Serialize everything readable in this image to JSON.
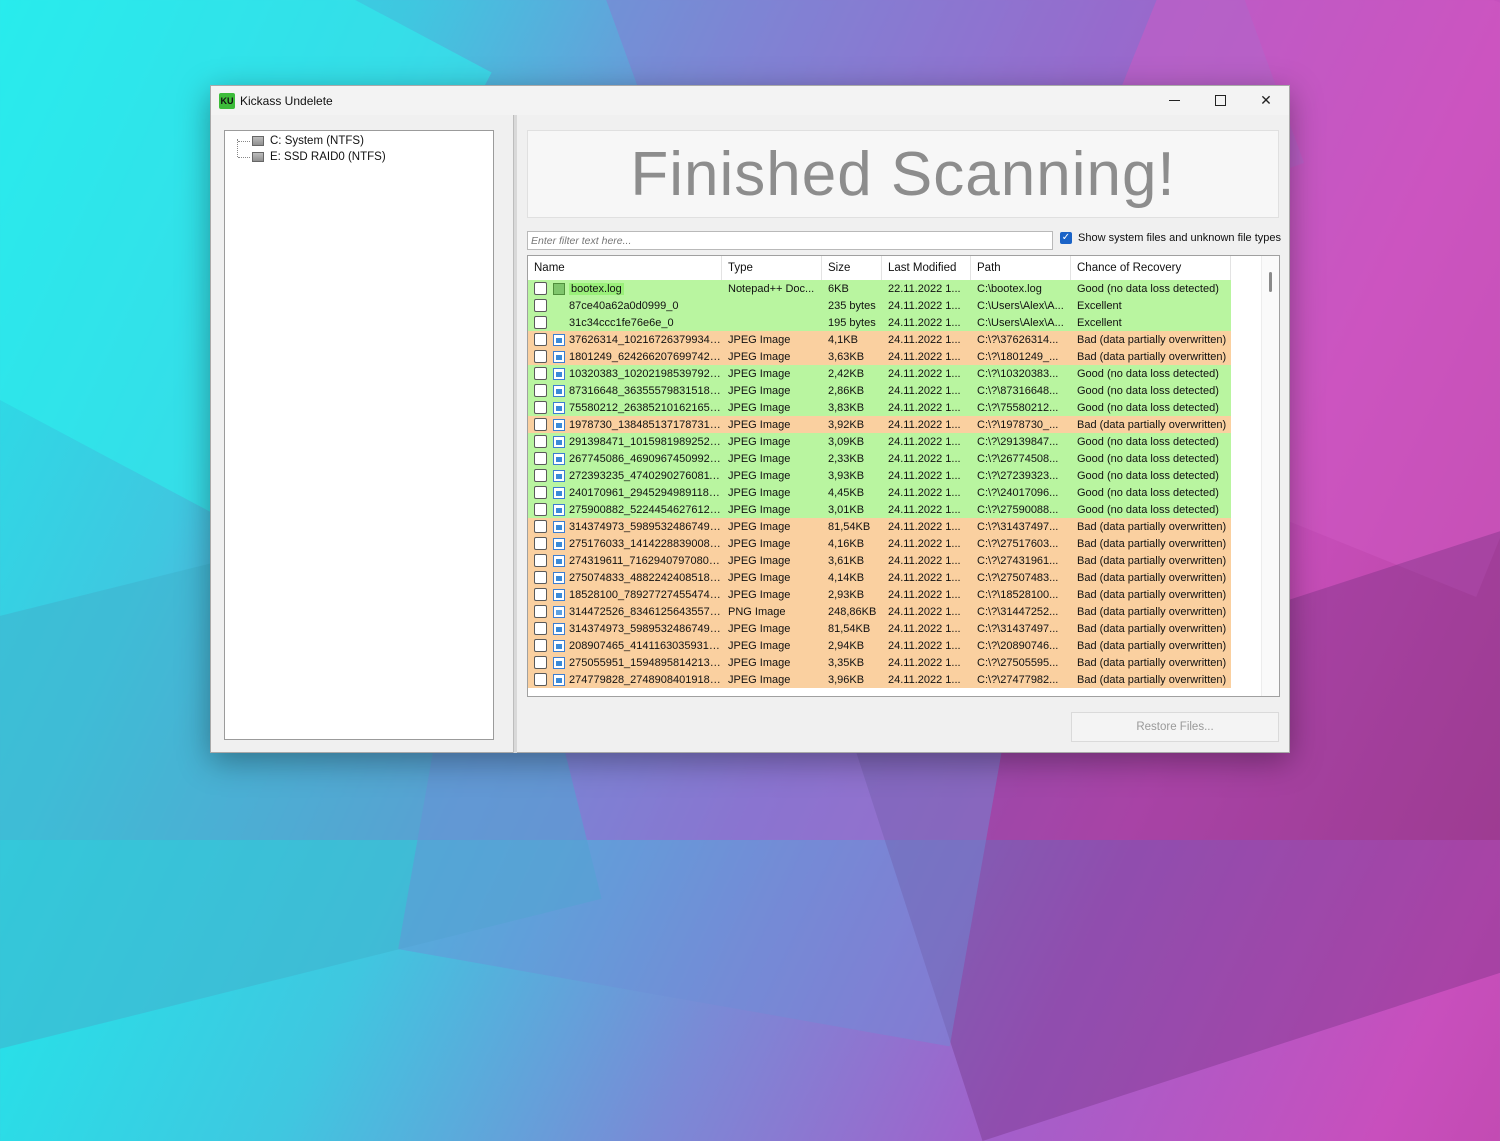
{
  "window": {
    "app_icon_text": "KU",
    "title": "Kickass Undelete",
    "controls": {
      "minimize": "minimize",
      "maximize": "maximize",
      "close": "✕"
    }
  },
  "drives": [
    {
      "label": "C: System (NTFS)"
    },
    {
      "label": "E: SSD RAID0 (NTFS)"
    }
  ],
  "banner": "Finished Scanning!",
  "filter": {
    "placeholder": "Enter filter text here...",
    "value": ""
  },
  "show_system_files": {
    "label": "Show system files and unknown file types",
    "checked": true
  },
  "table": {
    "columns": [
      "Name",
      "Type",
      "Size",
      "Last Modified",
      "Path",
      "Chance of Recovery"
    ],
    "rows": [
      {
        "name": "bootex.log",
        "type": "Notepad++ Doc...",
        "size": "6KB",
        "modified": "22.11.2022 1...",
        "path": "C:\\bootex.log",
        "chance": "Good (no data loss detected)",
        "status": "good",
        "icon": "txt"
      },
      {
        "name": "87ce40a62a0d0999_0",
        "type": "",
        "size": "235 bytes",
        "modified": "24.11.2022 1...",
        "path": "C:\\Users\\Alex\\A...",
        "chance": "Excellent",
        "status": "good",
        "icon": "none"
      },
      {
        "name": "31c34ccc1fe76e6e_0",
        "type": "",
        "size": "195 bytes",
        "modified": "24.11.2022 1...",
        "path": "C:\\Users\\Alex\\A...",
        "chance": "Excellent",
        "status": "good",
        "icon": "none"
      },
      {
        "name": "37626314_102167263799347...",
        "type": "JPEG Image",
        "size": "4,1KB",
        "modified": "24.11.2022 1...",
        "path": "C:\\?\\37626314...",
        "chance": "Bad (data partially overwritten)",
        "status": "bad",
        "icon": "jpeg"
      },
      {
        "name": "1801249_624266207699742_...",
        "type": "JPEG Image",
        "size": "3,63KB",
        "modified": "24.11.2022 1...",
        "path": "C:\\?\\1801249_...",
        "chance": "Bad (data partially overwritten)",
        "status": "bad",
        "icon": "jpeg"
      },
      {
        "name": "10320383_102021985397928...",
        "type": "JPEG Image",
        "size": "2,42KB",
        "modified": "24.11.2022 1...",
        "path": "C:\\?\\10320383...",
        "chance": "Good (no data loss detected)",
        "status": "good",
        "icon": "jpeg"
      },
      {
        "name": "87316648_363555798315187...",
        "type": "JPEG Image",
        "size": "2,86KB",
        "modified": "24.11.2022 1...",
        "path": "C:\\?\\87316648...",
        "chance": "Good (no data loss detected)",
        "status": "good",
        "icon": "jpeg"
      },
      {
        "name": "75580212_263852101621658...",
        "type": "JPEG Image",
        "size": "3,83KB",
        "modified": "24.11.2022 1...",
        "path": "C:\\?\\75580212...",
        "chance": "Good (no data loss detected)",
        "status": "good",
        "icon": "jpeg"
      },
      {
        "name": "1978730_1384851371787317...",
        "type": "JPEG Image",
        "size": "3,92KB",
        "modified": "24.11.2022 1...",
        "path": "C:\\?\\1978730_...",
        "chance": "Bad (data partially overwritten)",
        "status": "bad",
        "icon": "jpeg"
      },
      {
        "name": "291398471_10159819892523...",
        "type": "JPEG Image",
        "size": "3,09KB",
        "modified": "24.11.2022 1...",
        "path": "C:\\?\\29139847...",
        "chance": "Good (no data loss detected)",
        "status": "good",
        "icon": "jpeg"
      },
      {
        "name": "267745086_46909674509927...",
        "type": "JPEG Image",
        "size": "2,33KB",
        "modified": "24.11.2022 1...",
        "path": "C:\\?\\26774508...",
        "chance": "Good (no data loss detected)",
        "status": "good",
        "icon": "jpeg"
      },
      {
        "name": "272393235_47402902760811...",
        "type": "JPEG Image",
        "size": "3,93KB",
        "modified": "24.11.2022 1...",
        "path": "C:\\?\\27239323...",
        "chance": "Good (no data loss detected)",
        "status": "good",
        "icon": "jpeg"
      },
      {
        "name": "240170961_29452949891188...",
        "type": "JPEG Image",
        "size": "4,45KB",
        "modified": "24.11.2022 1...",
        "path": "C:\\?\\24017096...",
        "chance": "Good (no data loss detected)",
        "status": "good",
        "icon": "jpeg"
      },
      {
        "name": "275900882_52244546276128...",
        "type": "JPEG Image",
        "size": "3,01KB",
        "modified": "24.11.2022 1...",
        "path": "C:\\?\\27590088...",
        "chance": "Good (no data loss detected)",
        "status": "good",
        "icon": "jpeg"
      },
      {
        "name": "314374973_59895324867494...",
        "type": "JPEG Image",
        "size": "81,54KB",
        "modified": "24.11.2022 1...",
        "path": "C:\\?\\31437497...",
        "chance": "Bad (data partially overwritten)",
        "status": "bad",
        "icon": "jpeg"
      },
      {
        "name": "275176033_14142288390081...",
        "type": "JPEG Image",
        "size": "4,16KB",
        "modified": "24.11.2022 1...",
        "path": "C:\\?\\27517603...",
        "chance": "Bad (data partially overwritten)",
        "status": "bad",
        "icon": "jpeg"
      },
      {
        "name": "274319611_71629407970805...",
        "type": "JPEG Image",
        "size": "3,61KB",
        "modified": "24.11.2022 1...",
        "path": "C:\\?\\27431961...",
        "chance": "Bad (data partially overwritten)",
        "status": "bad",
        "icon": "jpeg"
      },
      {
        "name": "275074833_48822424085182...",
        "type": "JPEG Image",
        "size": "4,14KB",
        "modified": "24.11.2022 1...",
        "path": "C:\\?\\27507483...",
        "chance": "Bad (data partially overwritten)",
        "status": "bad",
        "icon": "jpeg"
      },
      {
        "name": "18528100_789277274554741...",
        "type": "JPEG Image",
        "size": "2,93KB",
        "modified": "24.11.2022 1...",
        "path": "C:\\?\\18528100...",
        "chance": "Bad (data partially overwritten)",
        "status": "bad",
        "icon": "jpeg"
      },
      {
        "name": "314472526_83461256435575...",
        "type": "PNG Image",
        "size": "248,86KB",
        "modified": "24.11.2022 1...",
        "path": "C:\\?\\31447252...",
        "chance": "Bad (data partially overwritten)",
        "status": "bad",
        "icon": "png"
      },
      {
        "name": "314374973_59895324867494...",
        "type": "JPEG Image",
        "size": "81,54KB",
        "modified": "24.11.2022 1...",
        "path": "C:\\?\\31437497...",
        "chance": "Bad (data partially overwritten)",
        "status": "bad",
        "icon": "jpeg"
      },
      {
        "name": "208907465_41411630359315...",
        "type": "JPEG Image",
        "size": "2,94KB",
        "modified": "24.11.2022 1...",
        "path": "C:\\?\\20890746...",
        "chance": "Bad (data partially overwritten)",
        "status": "bad",
        "icon": "jpeg"
      },
      {
        "name": "275055951_15948958142136...",
        "type": "JPEG Image",
        "size": "3,35KB",
        "modified": "24.11.2022 1...",
        "path": "C:\\?\\27505595...",
        "chance": "Bad (data partially overwritten)",
        "status": "bad",
        "icon": "jpeg"
      },
      {
        "name": "274779828_27489084019186...",
        "type": "JPEG Image",
        "size": "3,96KB",
        "modified": "24.11.2022 1...",
        "path": "C:\\?\\27477982...",
        "chance": "Bad (data partially overwritten)",
        "status": "bad",
        "icon": "jpeg"
      }
    ]
  },
  "restore_button": "Restore Files...",
  "colors": {
    "good_row": "#b9f5a0",
    "bad_row": "#fad0a0",
    "accent": "#1a63c7"
  }
}
